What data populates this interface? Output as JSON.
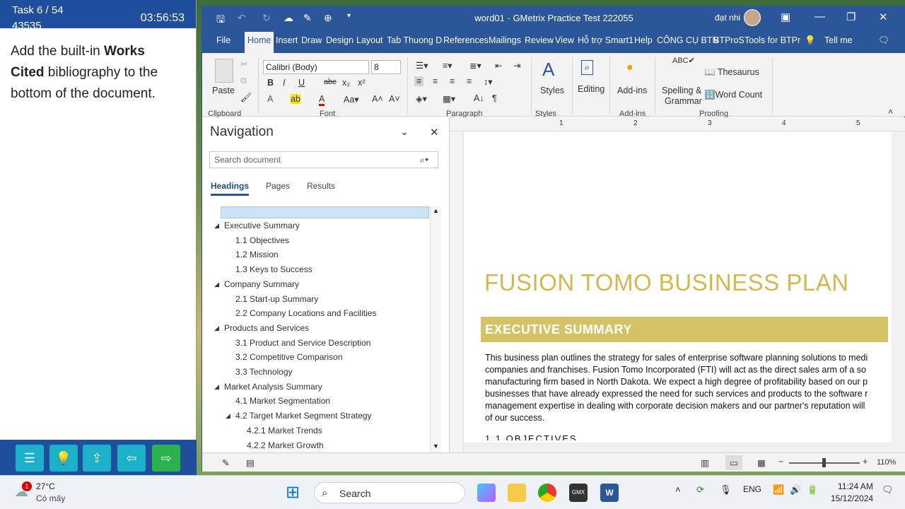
{
  "task": {
    "counter": "Task 6 / 54",
    "id": "43535",
    "timer": "03:56:53",
    "instruction_pre": "Add the built-in ",
    "instruction_bold1": "Works",
    "instruction_newline_bold": "Cited",
    "instruction_post": " bibliography to the bottom of the document."
  },
  "word": {
    "title": "word01  -  GMetrix Practice Test 222055",
    "user": "đạt nhi",
    "tabs": [
      "File",
      "Home",
      "Insert",
      "Draw",
      "Design",
      "Layout",
      "Tab Thuong D",
      "References",
      "Mailings",
      "Review",
      "View",
      "Hỗ trợ Smart1",
      "Help",
      "CÔNG CỤ BTN",
      "BTProS",
      "Tools for BTPr",
      "Tell me"
    ],
    "ribbon": {
      "paste": "Paste",
      "font_name": "Calibri (Body)",
      "font_size": "8",
      "styles": "Styles",
      "editing": "Editing",
      "addins": "Add-ins",
      "spelling": "Spelling &",
      "grammar": "Grammar",
      "thesaurus": "Thesaurus",
      "wordcount": "Word Count",
      "groups": [
        "Clipboard",
        "Font",
        "Paragraph",
        "Styles",
        "Add-ins",
        "Proofing"
      ]
    },
    "nav": {
      "title": "Navigation",
      "search_placeholder": "Search document",
      "tabs": [
        "Headings",
        "Pages",
        "Results"
      ],
      "headings": [
        {
          "text": "Executive Summary",
          "level": 1
        },
        {
          "text": "1.1 Objectives",
          "level": 2
        },
        {
          "text": "1.2 Mission",
          "level": 2
        },
        {
          "text": "1.3 Keys to Success",
          "level": 2
        },
        {
          "text": "Company Summary",
          "level": 1
        },
        {
          "text": "2.1 Start-up Summary",
          "level": 2
        },
        {
          "text": "2.2 Company Locations and Facilities",
          "level": 2
        },
        {
          "text": "Products and Services",
          "level": 1
        },
        {
          "text": "3.1 Product and Service Description",
          "level": 2
        },
        {
          "text": "3.2 Competitive Comparison",
          "level": 2
        },
        {
          "text": "3.3 Technology",
          "level": 2
        },
        {
          "text": "Market Analysis Summary",
          "level": 1
        },
        {
          "text": "4.1 Market Segmentation",
          "level": 2
        },
        {
          "text": "4.2 Target Market Segment Strategy",
          "level": 2
        },
        {
          "text": "4.2.1 Market Trends",
          "level": 3
        },
        {
          "text": "4.2.2 Market Growth",
          "level": 3
        }
      ]
    },
    "doc": {
      "title": "FUSION TOMO BUSINESS PLAN",
      "section": "EXECUTIVE SUMMARY",
      "lines": [
        "This business plan outlines the strategy for sales of enterprise software planning solutions to medi",
        "companies and franchises. Fusion Tomo Incorporated (FTI) will act as the direct sales arm of a so",
        "manufacturing firm based in North Dakota. We expect a high degree of profitability based on our p",
        "businesses that have already expressed the need for such services and products to the software r",
        "management expertise in dealing with corporate decision makers and our partner's reputation will",
        "of our success."
      ],
      "next_heading": "1.1 OBJECTIVES"
    },
    "ruler_numbers": [
      "1",
      "2",
      "3",
      "4",
      "5"
    ],
    "zoom": "110%"
  },
  "taskbar": {
    "temp": "27°C",
    "weather": "Có mây",
    "weather_badge": "1",
    "search": "Search",
    "lang": "ENG",
    "time": "11:24 AM",
    "date": "15/12/2024"
  }
}
